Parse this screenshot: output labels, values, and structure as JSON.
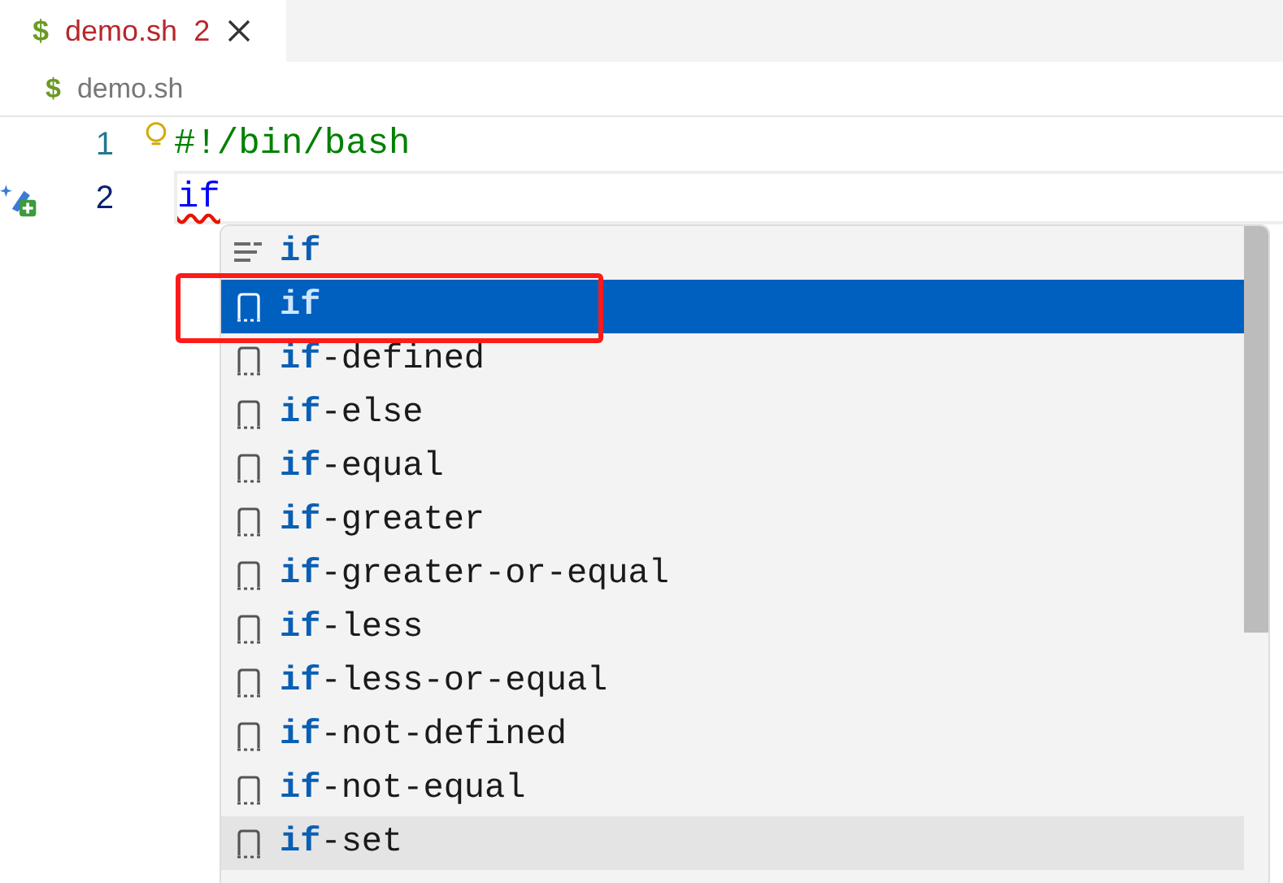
{
  "tab": {
    "icon": "$",
    "title": "demo.sh",
    "problems": "2",
    "has_errors": true
  },
  "breadcrumb": {
    "icon": "$",
    "file": "demo.sh"
  },
  "lines": [
    {
      "number": "1",
      "kind": "shebang",
      "text": "#!/bin/bash",
      "current": false,
      "error": false
    },
    {
      "number": "2",
      "kind": "keyword",
      "text": "if",
      "current": true,
      "error": true
    }
  ],
  "suggestions": [
    {
      "kind": "keyword",
      "match": "if",
      "selected": false,
      "hovered": false
    },
    {
      "kind": "snippet",
      "match": "if",
      "selected": true,
      "hovered": false
    },
    {
      "kind": "snippet",
      "match": "if",
      "rest": "-defined",
      "selected": false,
      "hovered": false
    },
    {
      "kind": "snippet",
      "match": "if",
      "rest": "-else",
      "selected": false,
      "hovered": false
    },
    {
      "kind": "snippet",
      "match": "if",
      "rest": "-equal",
      "selected": false,
      "hovered": false
    },
    {
      "kind": "snippet",
      "match": "if",
      "rest": "-greater",
      "selected": false,
      "hovered": false
    },
    {
      "kind": "snippet",
      "match": "if",
      "rest": "-greater-or-equal",
      "selected": false,
      "hovered": false
    },
    {
      "kind": "snippet",
      "match": "if",
      "rest": "-less",
      "selected": false,
      "hovered": false
    },
    {
      "kind": "snippet",
      "match": "if",
      "rest": "-less-or-equal",
      "selected": false,
      "hovered": false
    },
    {
      "kind": "snippet",
      "match": "if",
      "rest": "-not-defined",
      "selected": false,
      "hovered": false
    },
    {
      "kind": "snippet",
      "match": "if",
      "rest": "-not-equal",
      "selected": false,
      "hovered": false
    },
    {
      "kind": "snippet",
      "match": "if",
      "rest": "-set",
      "selected": false,
      "hovered": true
    }
  ]
}
